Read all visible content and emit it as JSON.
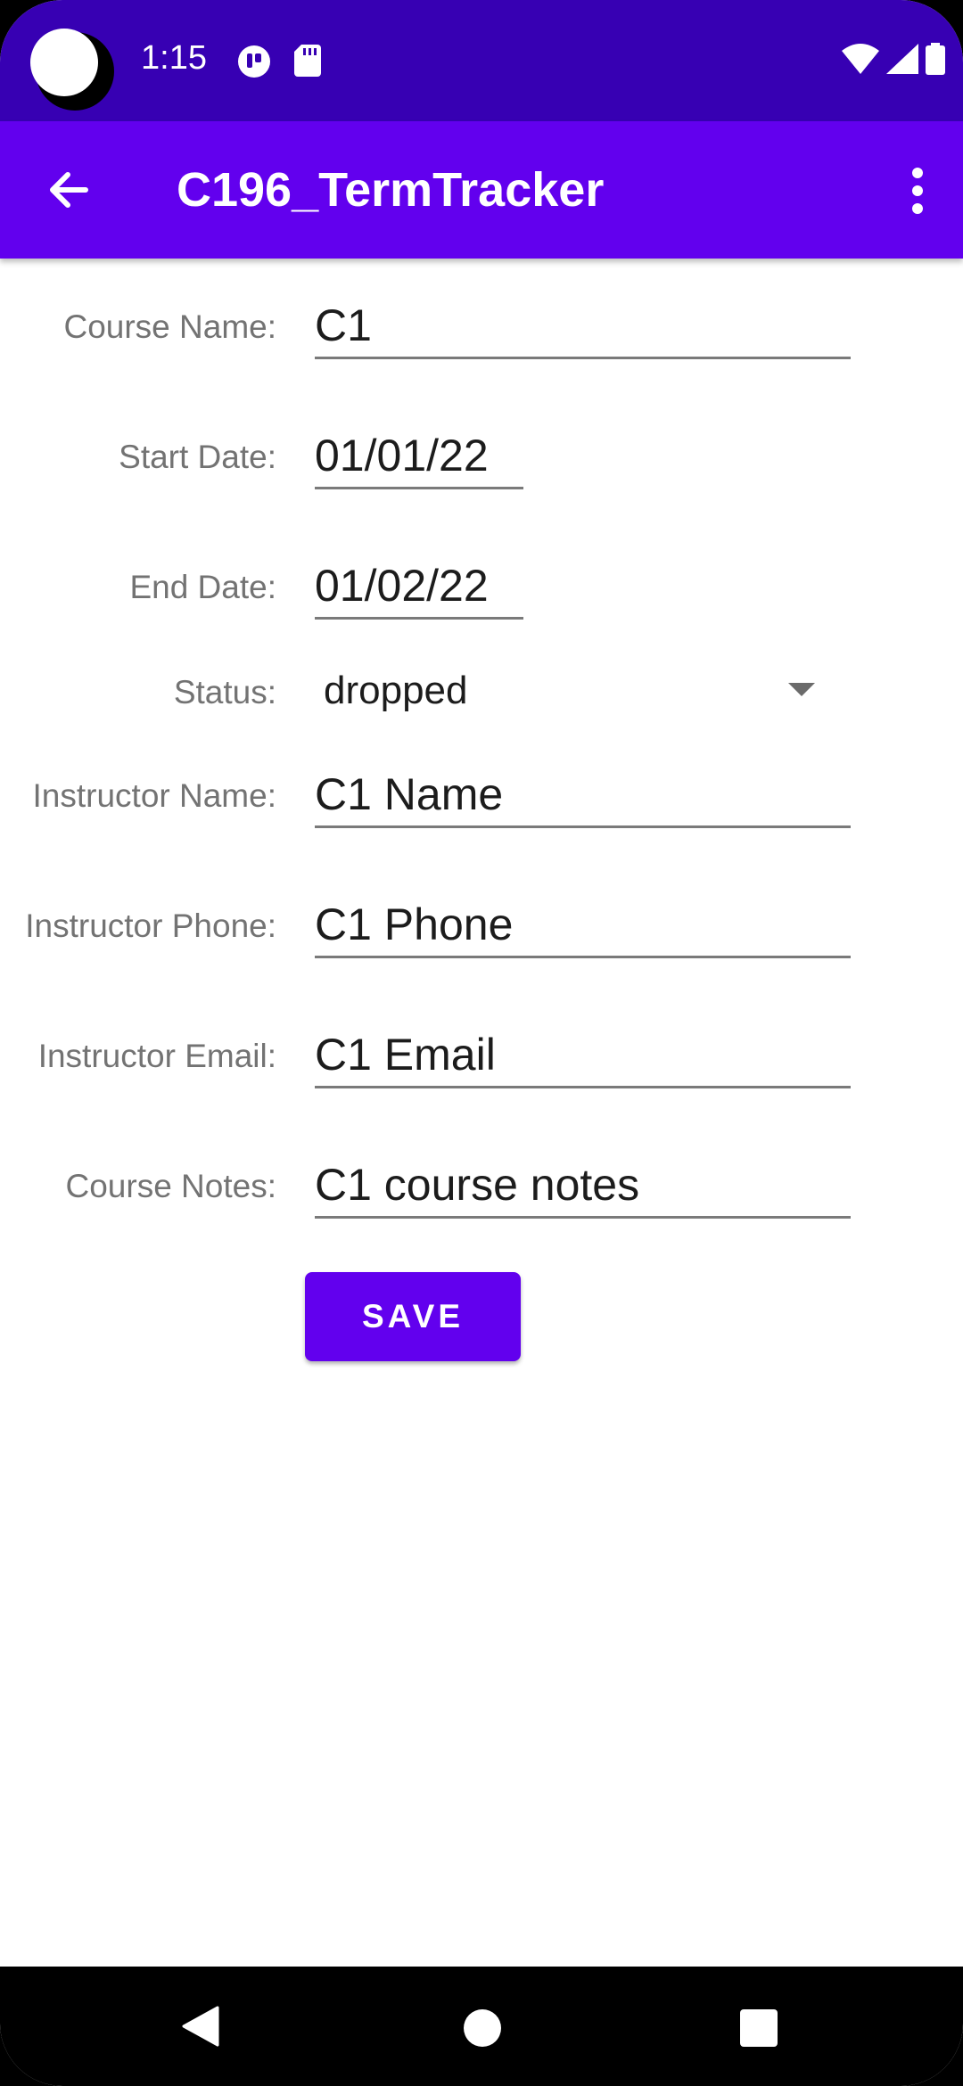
{
  "status_bar": {
    "time": "1:15"
  },
  "app_bar": {
    "title": "C196_TermTracker"
  },
  "form": {
    "course_name": {
      "label": "Course Name:",
      "value": "C1"
    },
    "start_date": {
      "label": "Start Date:",
      "value": "01/01/22"
    },
    "end_date": {
      "label": "End Date:",
      "value": "01/02/22"
    },
    "status": {
      "label": "Status:",
      "value": "dropped"
    },
    "instructor_name": {
      "label": "Instructor Name:",
      "value": "C1 Name"
    },
    "instructor_phone": {
      "label": "Instructor Phone:",
      "value": "C1 Phone"
    },
    "instructor_email": {
      "label": "Instructor Email:",
      "value": "C1 Email"
    },
    "course_notes": {
      "label": "Course Notes:",
      "value": "C1 course notes"
    }
  },
  "actions": {
    "save_label": "SAVE"
  },
  "colors": {
    "status_bar": "#3700B3",
    "primary": "#6200EE"
  },
  "icons": {
    "back": "arrow-left-icon",
    "overflow": "more-vert-icon",
    "dropdown": "arrow-drop-down-icon"
  }
}
